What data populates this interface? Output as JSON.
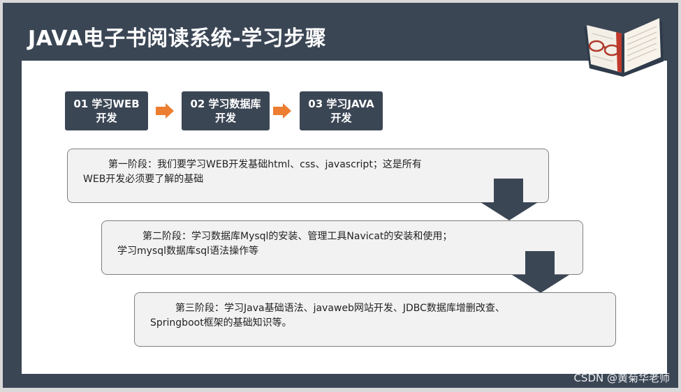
{
  "slide": {
    "title": "JAVA电子书阅读系统-学习步骤"
  },
  "steps": [
    {
      "line1": "01 学习WEB",
      "line2": "开发"
    },
    {
      "line1": "02 学习数据库",
      "line2": "开发"
    },
    {
      "line1": "03 学习JAVA",
      "line2": "开发"
    }
  ],
  "stages": [
    {
      "line1": "第一阶段：我们要学习WEB开发基础html、css、javascript；这是所有",
      "line2": "WEB开发必须要了解的基础"
    },
    {
      "line1": "第二阶段：学习数据库Mysql的安装、管理工具Navicat的安装和使用；",
      "line2": "学习mysql数据库sql语法操作等"
    },
    {
      "line1": "第三阶段：学习Java基础语法、javaweb网站开发、JDBC数据库增删改查、",
      "line2": "Springboot框架的基础知识等。"
    }
  ],
  "watermark": "CSDN @黄菊华老师",
  "colors": {
    "dark": "#3b4655",
    "accent_arrow": "#ed7d31",
    "stage_bg": "#f2f2f2",
    "page": "#ffffff"
  },
  "icons": {
    "book": "open-book-with-glasses-icon",
    "right_arrow": "orange-right-arrow-icon",
    "down_arrow": "dark-down-arrow-icon"
  }
}
